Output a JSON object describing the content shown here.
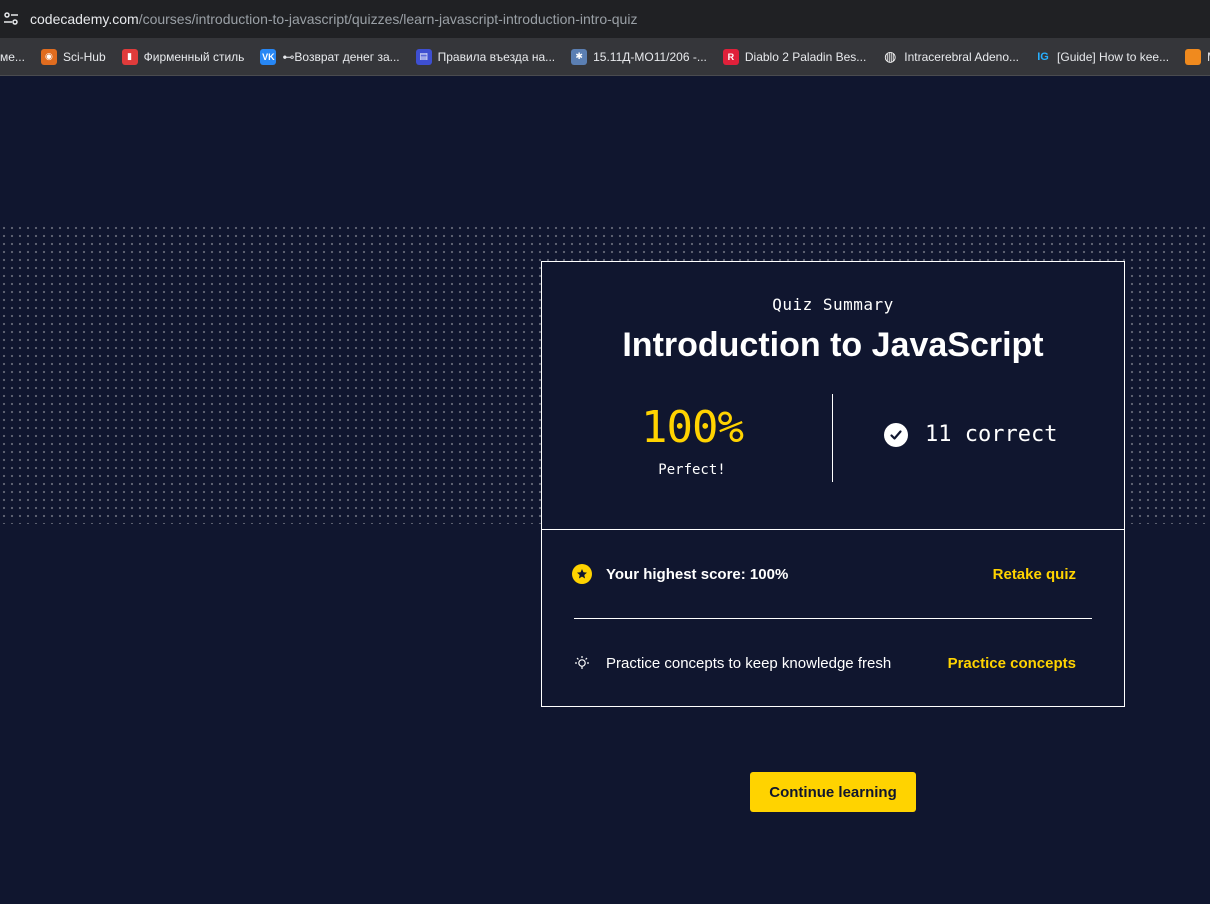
{
  "browser": {
    "url_host": "codecademy.com",
    "url_path": "/courses/introduction-to-javascript/quizzes/learn-javascript-introduction-intro-quiz"
  },
  "bookmarks": [
    {
      "label": "ме...",
      "icon": "partial-favicon",
      "color": "#e06c1f"
    },
    {
      "label": "Sci-Hub",
      "icon": "scihub-eye-icon",
      "color": "#e06c1f"
    },
    {
      "label": "Фирменный стиль",
      "icon": "bookmark-red-icon",
      "color": "#e03b3b"
    },
    {
      "label": "⊷Возврат денег за...",
      "icon": "vk-icon",
      "color": "#2787f5"
    },
    {
      "label": "Правила въезда на...",
      "icon": "doc-icon",
      "color": "#3e4fd1"
    },
    {
      "label": "15.11Д-МО11/206 -...",
      "icon": "seal-icon",
      "color": "#5b7fb3"
    },
    {
      "label": "Diablo 2 Paladin Bes...",
      "icon": "r-icon",
      "color": "#e0203a"
    },
    {
      "label": "Intracerebral Adeno...",
      "icon": "globe-icon",
      "color": "#ffffff"
    },
    {
      "label": "[Guide] How to kee...",
      "icon": "ig-icon",
      "color": "#27b0ff"
    },
    {
      "label": "M",
      "icon": "partial-favicon",
      "color": "#f08a1e"
    }
  ],
  "quiz": {
    "summary_label": "Quiz Summary",
    "title": "Introduction to JavaScript",
    "score": "100%",
    "score_note": "Perfect!",
    "correct_text": "11 correct"
  },
  "actions": {
    "highest_score_text": "Your highest score: 100%",
    "retake_label": "Retake quiz",
    "practice_text": "Practice concepts to keep knowledge fresh",
    "practice_label": "Practice concepts"
  },
  "continue_label": "Continue learning",
  "colors": {
    "background": "#10162f",
    "accent": "#ffd300",
    "text": "#ffffff"
  }
}
